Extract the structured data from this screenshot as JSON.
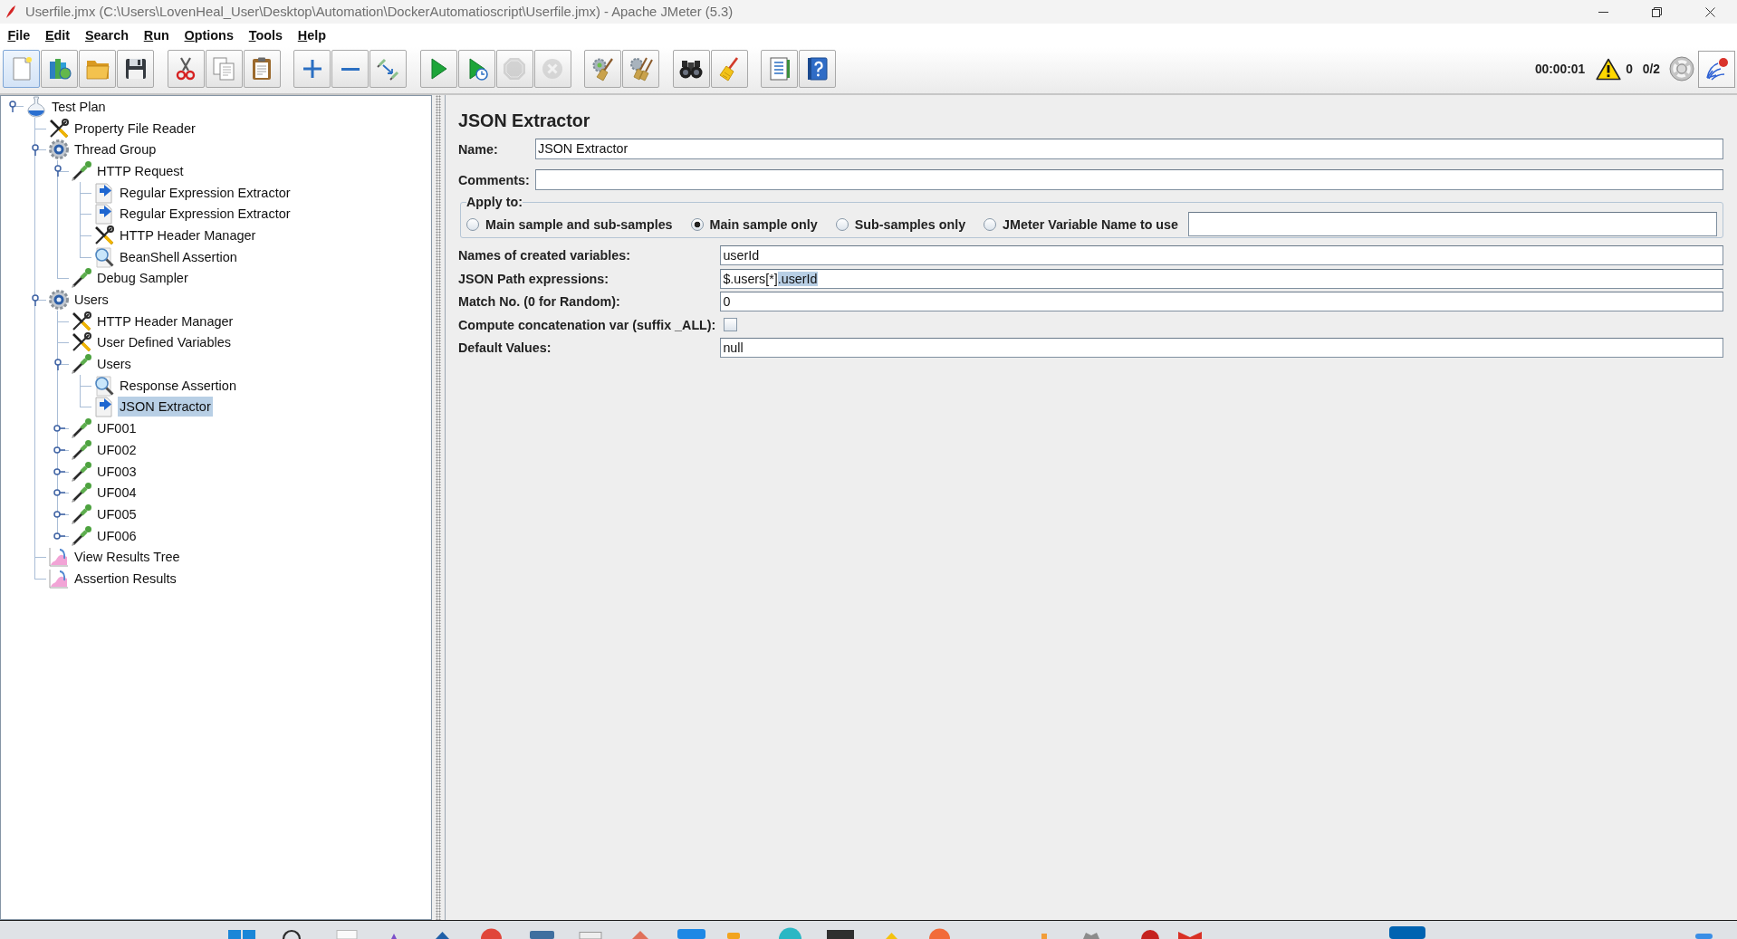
{
  "window": {
    "title": "Userfile.jmx (C:\\Users\\LovenHeal_User\\Desktop\\Automation\\DockerAutomatioscript\\Userfile.jmx) - Apache JMeter (5.3)"
  },
  "menu": [
    "File",
    "Edit",
    "Search",
    "Run",
    "Options",
    "Tools",
    "Help"
  ],
  "toolbar": [
    {
      "buttons": [
        {
          "kind": "new",
          "highlighted": true,
          "disabled": false
        },
        {
          "kind": "templates",
          "highlighted": false,
          "disabled": false
        },
        {
          "kind": "open",
          "highlighted": false,
          "disabled": false
        },
        {
          "kind": "save",
          "highlighted": false,
          "disabled": false
        }
      ]
    },
    {
      "buttons": [
        {
          "kind": "cut",
          "highlighted": false,
          "disabled": false
        },
        {
          "kind": "copy",
          "highlighted": false,
          "disabled": false
        },
        {
          "kind": "paste",
          "highlighted": false,
          "disabled": false
        }
      ]
    },
    {
      "buttons": [
        {
          "kind": "expand",
          "highlighted": false,
          "disabled": false
        },
        {
          "kind": "collapse",
          "highlighted": false,
          "disabled": false
        },
        {
          "kind": "toggle",
          "highlighted": false,
          "disabled": false
        }
      ]
    },
    {
      "buttons": [
        {
          "kind": "start",
          "highlighted": false,
          "disabled": false
        },
        {
          "kind": "start_no_pauses",
          "highlighted": false,
          "disabled": false
        },
        {
          "kind": "stop",
          "highlighted": false,
          "disabled": true
        },
        {
          "kind": "shutdown",
          "highlighted": false,
          "disabled": true
        }
      ]
    },
    {
      "buttons": [
        {
          "kind": "clear",
          "highlighted": false,
          "disabled": false
        },
        {
          "kind": "clear_all",
          "highlighted": false,
          "disabled": false
        }
      ]
    },
    {
      "buttons": [
        {
          "kind": "search",
          "highlighted": false,
          "disabled": false
        },
        {
          "kind": "reset_search",
          "highlighted": false,
          "disabled": false
        }
      ]
    },
    {
      "buttons": [
        {
          "kind": "function_helper",
          "highlighted": false,
          "disabled": false
        },
        {
          "kind": "help",
          "highlighted": false,
          "disabled": false
        }
      ]
    }
  ],
  "status": {
    "elapsed": "00:00:01",
    "warnings": "0",
    "threads": "0/2"
  },
  "tree": {
    "label": "Test Plan",
    "kind": "test_plan",
    "expanded": true,
    "selected": false,
    "children": [
      {
        "label": "Property File Reader",
        "kind": "config",
        "selected": false
      },
      {
        "label": "Thread Group",
        "kind": "thread_group",
        "expanded": true,
        "selected": false,
        "children": [
          {
            "label": "HTTP Request",
            "kind": "sampler",
            "expanded": true,
            "selected": false,
            "children": [
              {
                "label": "Regular Expression Extractor",
                "kind": "extractor",
                "selected": false
              },
              {
                "label": "Regular Expression Extractor",
                "kind": "extractor",
                "selected": false
              },
              {
                "label": "HTTP Header Manager",
                "kind": "config",
                "selected": false
              },
              {
                "label": "BeanShell Assertion",
                "kind": "assertion",
                "selected": false
              }
            ]
          },
          {
            "label": "Debug Sampler",
            "kind": "sampler",
            "selected": false
          }
        ]
      },
      {
        "label": "Users",
        "kind": "thread_group",
        "expanded": true,
        "selected": false,
        "children": [
          {
            "label": "HTTP Header Manager",
            "kind": "config",
            "selected": false
          },
          {
            "label": "User Defined Variables",
            "kind": "config",
            "selected": false
          },
          {
            "label": "Users",
            "kind": "sampler",
            "expanded": true,
            "selected": false,
            "children": [
              {
                "label": "Response Assertion",
                "kind": "assertion",
                "selected": false
              },
              {
                "label": "JSON Extractor",
                "kind": "extractor",
                "selected": true
              }
            ]
          },
          {
            "label": "UF001",
            "kind": "sampler",
            "expanded": false,
            "selected": false
          },
          {
            "label": "UF002",
            "kind": "sampler",
            "expanded": false,
            "selected": false
          },
          {
            "label": "UF003",
            "kind": "sampler",
            "expanded": false,
            "selected": false
          },
          {
            "label": "UF004",
            "kind": "sampler",
            "expanded": false,
            "selected": false
          },
          {
            "label": "UF005",
            "kind": "sampler",
            "expanded": false,
            "selected": false
          },
          {
            "label": "UF006",
            "kind": "sampler",
            "expanded": false,
            "selected": false
          }
        ]
      },
      {
        "label": "View Results Tree",
        "kind": "listener",
        "selected": false
      },
      {
        "label": "Assertion Results",
        "kind": "listener",
        "selected": false
      }
    ]
  },
  "editor": {
    "title": "JSON Extractor",
    "name": {
      "label": "Name:",
      "value": "JSON Extractor"
    },
    "comments": {
      "label": "Comments:"
    },
    "apply_to": {
      "legend": "Apply to:",
      "options": [
        {
          "label": "Main sample and sub-samples",
          "kind": "plain",
          "selected": false
        },
        {
          "label": "Main sample only",
          "kind": "plain",
          "selected": true
        },
        {
          "label": "Sub-samples only",
          "kind": "plain",
          "selected": false
        },
        {
          "label": "JMeter Variable Name to use",
          "kind": "with_field",
          "selected": false
        }
      ]
    },
    "fields": [
      {
        "kind": "text",
        "label": "Names of created variables:",
        "value": "userId"
      },
      {
        "kind": "partly_selected_text",
        "label": "JSON Path expressions:",
        "value_parts": [
          {
            "text": "$.users[*]",
            "selected": false
          },
          {
            "text": ".userId",
            "selected": true
          }
        ]
      },
      {
        "kind": "text",
        "label": "Match No. (0 for Random):",
        "value": "0"
      },
      {
        "kind": "checkbox",
        "label": "Compute concatenation var (suffix _ALL):",
        "checked": false
      },
      {
        "kind": "text",
        "label": "Default Values:",
        "value": "null"
      }
    ]
  }
}
